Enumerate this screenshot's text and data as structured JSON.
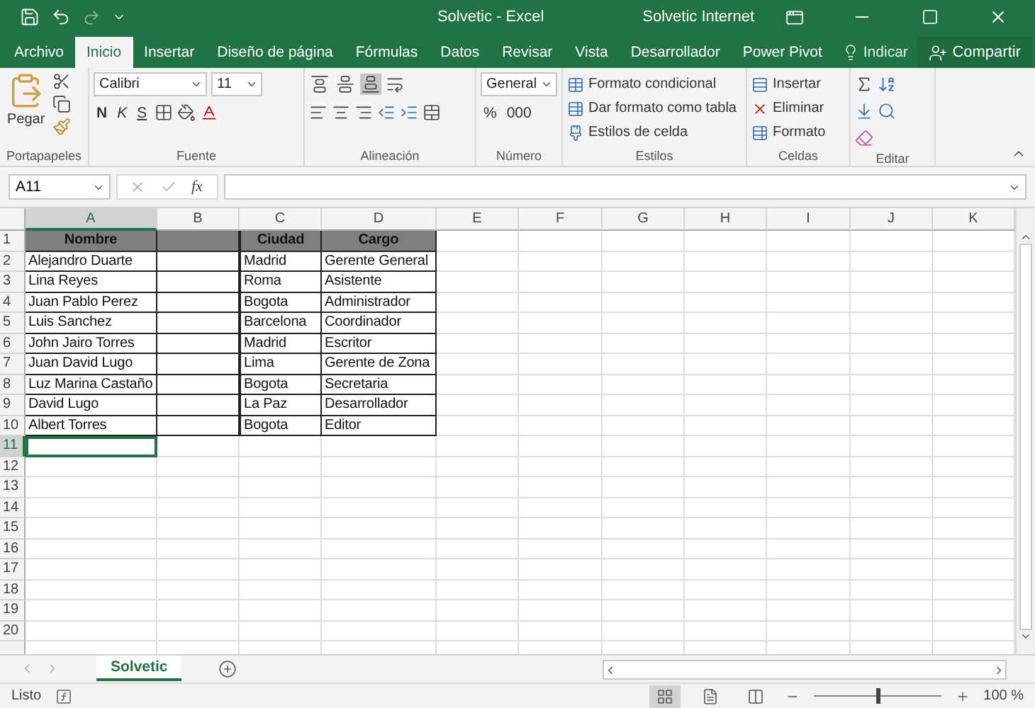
{
  "window": {
    "title": "Solvetic - Excel",
    "user": "Solvetic Internet"
  },
  "tabs": [
    {
      "label": "Archivo",
      "selected": false
    },
    {
      "label": "Inicio",
      "selected": true
    },
    {
      "label": "Insertar",
      "selected": false
    },
    {
      "label": "Diseño de página",
      "selected": false
    },
    {
      "label": "Fórmulas",
      "selected": false
    },
    {
      "label": "Datos",
      "selected": false
    },
    {
      "label": "Revisar",
      "selected": false
    },
    {
      "label": "Vista",
      "selected": false
    },
    {
      "label": "Desarrollador",
      "selected": false
    },
    {
      "label": "Power Pivot",
      "selected": false
    }
  ],
  "tell_me": "Indicar",
  "share": "Compartir",
  "ribbon": {
    "clipboard": {
      "paste": "Pegar",
      "label": "Portapapeles"
    },
    "font": {
      "name": "Calibri",
      "size": "11",
      "bold": "N",
      "italic": "K",
      "underline": "S",
      "label": "Fuente"
    },
    "alignment": {
      "label": "Alineación",
      "vertical": [
        {
          "kind": "top",
          "selected": false
        },
        {
          "kind": "middle",
          "selected": false
        },
        {
          "kind": "bottom",
          "selected": true
        }
      ]
    },
    "number": {
      "format": "General",
      "percent": "%",
      "thousands": "000",
      "label": "Número"
    },
    "styles": {
      "items": [
        "Formato condicional",
        "Dar formato como tabla",
        "Estilos de celda"
      ],
      "label": "Estilos"
    },
    "cells": {
      "items": [
        "Insertar",
        "Eliminar",
        "Formato"
      ],
      "label": "Celdas"
    },
    "editing": {
      "label": "Editar"
    }
  },
  "formula_bar": {
    "name_box": "A11",
    "fx": "fx"
  },
  "sheet": {
    "columns": [
      {
        "letter": "A",
        "selected": true
      },
      {
        "letter": "B",
        "selected": false
      },
      {
        "letter": "C",
        "selected": false
      },
      {
        "letter": "D",
        "selected": false
      },
      {
        "letter": "E",
        "selected": false
      },
      {
        "letter": "F",
        "selected": false
      },
      {
        "letter": "G",
        "selected": false
      },
      {
        "letter": "H",
        "selected": false
      },
      {
        "letter": "I",
        "selected": false
      },
      {
        "letter": "J",
        "selected": false
      },
      {
        "letter": "K",
        "selected": false
      }
    ],
    "rows": [
      {
        "number": "1",
        "kind": "header",
        "selected": false,
        "a": "Nombre",
        "c": "Ciudad",
        "d": "Cargo"
      },
      {
        "number": "2",
        "kind": "data",
        "selected": false,
        "a": "Alejandro Duarte",
        "c": "Madrid",
        "d": "Gerente General"
      },
      {
        "number": "3",
        "kind": "data",
        "selected": false,
        "a": "Lina Reyes",
        "c": "Roma",
        "d": "Asistente"
      },
      {
        "number": "4",
        "kind": "data",
        "selected": false,
        "a": "Juan Pablo Perez",
        "c": "Bogota",
        "d": "Administrador"
      },
      {
        "number": "5",
        "kind": "data",
        "selected": false,
        "a": "Luis Sanchez",
        "c": "Barcelona",
        "d": "Coordinador"
      },
      {
        "number": "6",
        "kind": "data",
        "selected": false,
        "a": "John Jairo Torres",
        "c": "Madrid",
        "d": "Escritor"
      },
      {
        "number": "7",
        "kind": "data",
        "selected": false,
        "a": "Juan David Lugo",
        "c": "Lima",
        "d": "Gerente de Zona"
      },
      {
        "number": "8",
        "kind": "data",
        "selected": false,
        "a": "Luz Marina Castaño",
        "c": "Bogota",
        "d": "Secretaria"
      },
      {
        "number": "9",
        "kind": "data",
        "selected": false,
        "a": "David Lugo",
        "c": "La Paz",
        "d": "Desarrollador"
      },
      {
        "number": "10",
        "kind": "data",
        "selected": false,
        "a": "Albert Torres",
        "c": "Bogota",
        "d": "Editor"
      },
      {
        "number": "11",
        "kind": "empty",
        "selected": true
      },
      {
        "number": "12",
        "kind": "empty",
        "selected": false
      },
      {
        "number": "13",
        "kind": "empty",
        "selected": false
      },
      {
        "number": "14",
        "kind": "empty",
        "selected": false
      },
      {
        "number": "15",
        "kind": "empty",
        "selected": false
      },
      {
        "number": "16",
        "kind": "empty",
        "selected": false
      },
      {
        "number": "17",
        "kind": "empty",
        "selected": false
      },
      {
        "number": "18",
        "kind": "empty",
        "selected": false
      },
      {
        "number": "19",
        "kind": "empty",
        "selected": false
      },
      {
        "number": "20",
        "kind": "empty",
        "selected": false
      }
    ]
  },
  "sheet_tabs": [
    {
      "label": "Solvetic",
      "selected": true
    }
  ],
  "status_bar": {
    "status": "Listo",
    "views": [
      {
        "kind": "normal",
        "selected": true
      },
      {
        "kind": "page-layout",
        "selected": false
      },
      {
        "kind": "page-break",
        "selected": false
      }
    ],
    "zoom_slider": {
      "level": 0.5
    },
    "zoom": "100 %"
  }
}
